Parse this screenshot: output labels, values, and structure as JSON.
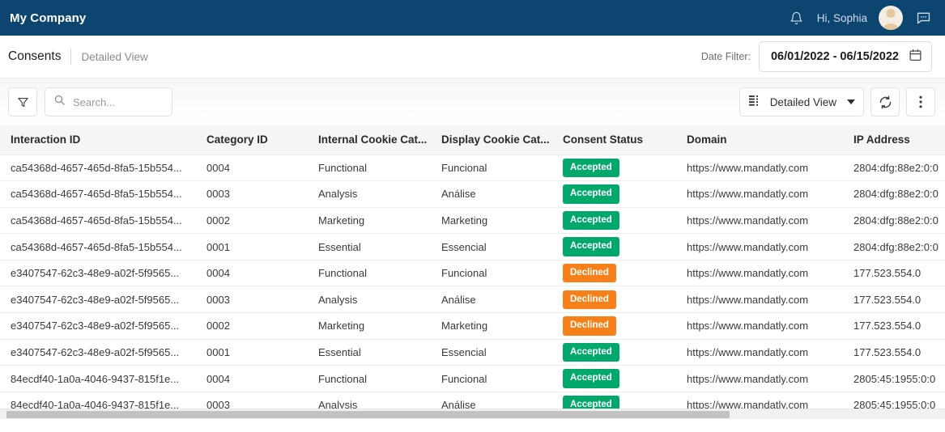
{
  "topbar": {
    "brand": "My Company",
    "notification_icon": "bell-icon",
    "greeting": "Hi, Sophia",
    "avatar_label": "user-avatar",
    "chat_icon": "chat-icon",
    "background_color": "#0c4570"
  },
  "titlerow": {
    "breadcrumb_main": "Consents",
    "breadcrumb_sub": "Detailed View",
    "date_filter_label": "Date Filter:",
    "date_filter_value": "06/01/2022 - 06/15/2022",
    "calendar_icon": "calendar-icon"
  },
  "toolbar": {
    "filter_icon": "filter-funnel-icon",
    "search_icon": "search-icon",
    "search_value": "",
    "search_placeholder": "Search...",
    "view_select_label": "Detailed View",
    "view_select_icon": "list-view-icon",
    "refresh_icon": "refresh-icon",
    "more_icon": "more-vertical-icon"
  },
  "table": {
    "columns": [
      "Interaction ID",
      "Category ID",
      "Internal Cookie Cat...",
      "Display Cookie Cat...",
      "Consent Status",
      "Domain",
      "IP Address"
    ],
    "rows": [
      {
        "interaction_id": "ca54368d-4657-465d-8fa5-15b554...",
        "category_id": "0004",
        "internal_cookie_cat": "Functional",
        "display_cookie_cat": "Funcional",
        "consent_status": "Accepted",
        "domain": "https://www.mandatly.com",
        "ip_address": "2804:dfg:88e2:0:0"
      },
      {
        "interaction_id": "ca54368d-4657-465d-8fa5-15b554...",
        "category_id": "0003",
        "internal_cookie_cat": "Analysis",
        "display_cookie_cat": "Análise",
        "consent_status": "Accepted",
        "domain": "https://www.mandatly.com",
        "ip_address": "2804:dfg:88e2:0:0"
      },
      {
        "interaction_id": "ca54368d-4657-465d-8fa5-15b554...",
        "category_id": "0002",
        "internal_cookie_cat": "Marketing",
        "display_cookie_cat": "Marketing",
        "consent_status": "Accepted",
        "domain": "https://www.mandatly.com",
        "ip_address": "2804:dfg:88e2:0:0"
      },
      {
        "interaction_id": "ca54368d-4657-465d-8fa5-15b554...",
        "category_id": "0001",
        "internal_cookie_cat": "Essential",
        "display_cookie_cat": "Essencial",
        "consent_status": "Accepted",
        "domain": "https://www.mandatly.com",
        "ip_address": "2804:dfg:88e2:0:0"
      },
      {
        "interaction_id": "e3407547-62c3-48e9-a02f-5f9565...",
        "category_id": "0004",
        "internal_cookie_cat": "Functional",
        "display_cookie_cat": "Funcional",
        "consent_status": "Declined",
        "domain": "https://www.mandatly.com",
        "ip_address": "177.523.554.0"
      },
      {
        "interaction_id": "e3407547-62c3-48e9-a02f-5f9565...",
        "category_id": "0003",
        "internal_cookie_cat": "Analysis",
        "display_cookie_cat": "Análise",
        "consent_status": "Declined",
        "domain": "https://www.mandatly.com",
        "ip_address": "177.523.554.0"
      },
      {
        "interaction_id": "e3407547-62c3-48e9-a02f-5f9565...",
        "category_id": "0002",
        "internal_cookie_cat": "Marketing",
        "display_cookie_cat": "Marketing",
        "consent_status": "Declined",
        "domain": "https://www.mandatly.com",
        "ip_address": "177.523.554.0"
      },
      {
        "interaction_id": "e3407547-62c3-48e9-a02f-5f9565...",
        "category_id": "0001",
        "internal_cookie_cat": "Essential",
        "display_cookie_cat": "Essencial",
        "consent_status": "Accepted",
        "domain": "https://www.mandatly.com",
        "ip_address": "177.523.554.0"
      },
      {
        "interaction_id": "84ecdf40-1a0a-4046-9437-815f1e...",
        "category_id": "0004",
        "internal_cookie_cat": "Functional",
        "display_cookie_cat": "Funcional",
        "consent_status": "Accepted",
        "domain": "https://www.mandatly.com",
        "ip_address": "2805:45:1955:0:0"
      },
      {
        "interaction_id": "84ecdf40-1a0a-4046-9437-815f1e...",
        "category_id": "0003",
        "internal_cookie_cat": "Analysis",
        "display_cookie_cat": "Análise",
        "consent_status": "Accepted",
        "domain": "https://www.mandatly.com",
        "ip_address": "2805:45:1955:0:0"
      }
    ]
  },
  "status_colors": {
    "accepted": "#00a96b",
    "declined": "#f7801a"
  },
  "scrollbar": {
    "orientation": "horizontal",
    "thumb_fraction": 0.77
  }
}
